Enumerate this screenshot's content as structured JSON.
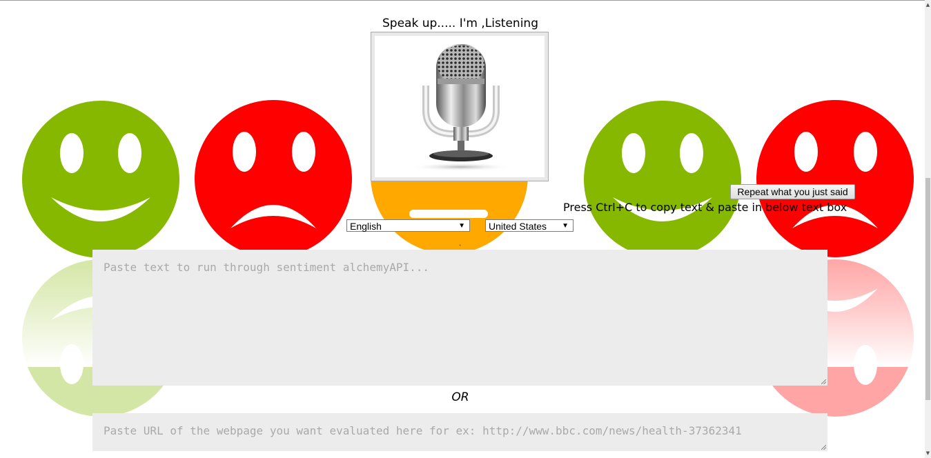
{
  "header": {
    "title": "Speak up..... I'm ,Listening"
  },
  "microphone": {
    "icon": "microphone-icon"
  },
  "faces": [
    {
      "mood": "happy",
      "color": "#86b800"
    },
    {
      "mood": "sad",
      "color": "#ff0000"
    },
    {
      "mood": "neutral",
      "color": "#ffa800"
    },
    {
      "mood": "happy",
      "color": "#86b800"
    },
    {
      "mood": "sad",
      "color": "#ff0000"
    }
  ],
  "controls": {
    "language_selected": "English",
    "region_selected": "United States",
    "repeat_label": "Repeat what you just said",
    "copy_hint": "Press Ctrl+C to copy text & paste in below text box",
    "status_dot": "."
  },
  "sentiment_input": {
    "placeholder": "Paste text to run through sentiment alchemyAPI..."
  },
  "separator": {
    "label": "OR"
  },
  "url_input": {
    "placeholder": "Paste URL of the webpage you want evaluated here for ex: http://www.bbc.com/news/health-37362341"
  }
}
